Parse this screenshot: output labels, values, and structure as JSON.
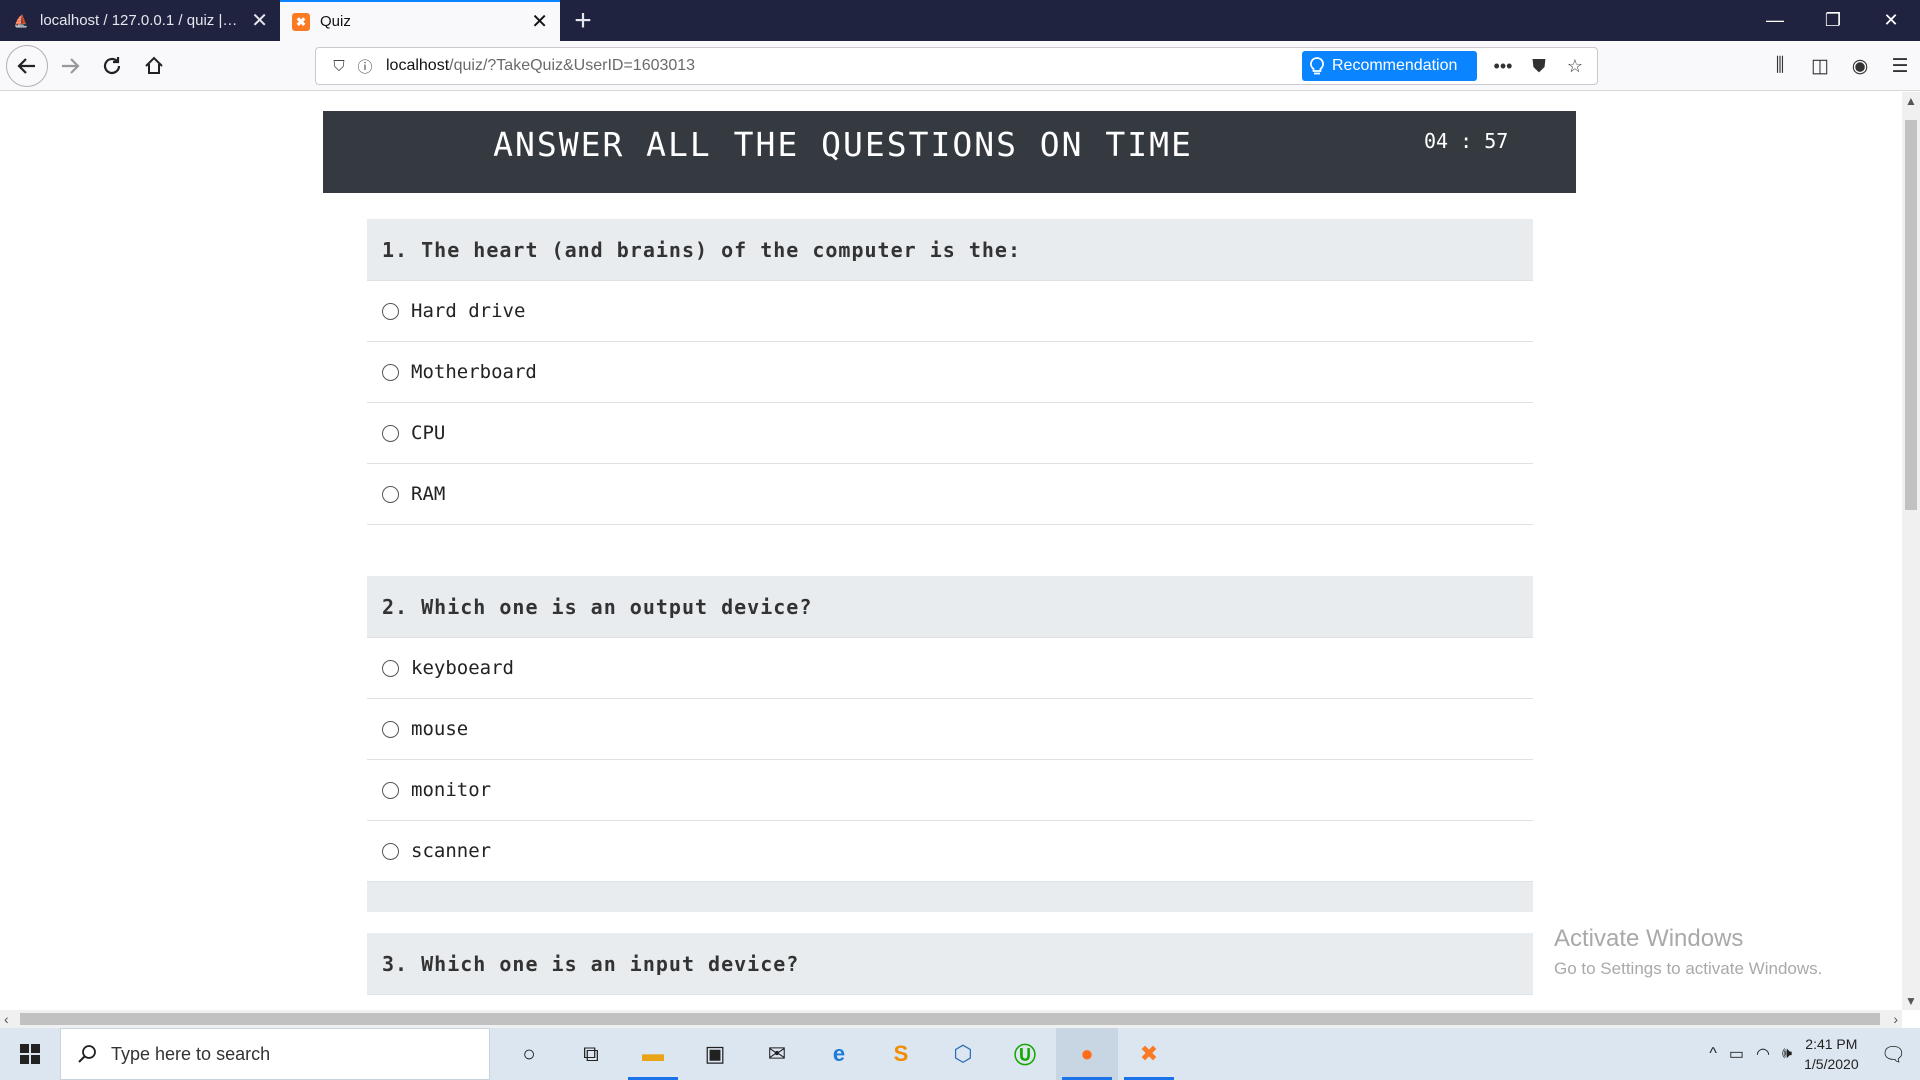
{
  "browser": {
    "tabs": [
      {
        "title": "localhost / 127.0.0.1 / quiz | php",
        "favicon": "phpmyadmin-icon",
        "active": false
      },
      {
        "title": "Quiz",
        "favicon": "xampp-icon",
        "active": true
      }
    ],
    "new_tab_label": "+",
    "url_host": "localhost",
    "url_path": "/quiz/?TakeQuiz&UserID=1603013",
    "recommendation_label": "Recommendation"
  },
  "page": {
    "banner_title": "ANSWER ALL THE QUESTIONS ON TIME",
    "timer": "04 : 57",
    "questions": [
      {
        "text": "1. The heart (and brains) of the computer is the:",
        "options": [
          "Hard drive",
          "Motherboard",
          "CPU",
          "RAM"
        ]
      },
      {
        "text": "2. Which one is an output device?",
        "options": [
          "keyboeard",
          "mouse",
          "monitor",
          "scanner"
        ]
      },
      {
        "text": "3. Which one is an input device?",
        "options": []
      }
    ]
  },
  "watermark": {
    "line1": "Activate Windows",
    "line2": "Go to Settings to activate Windows."
  },
  "taskbar": {
    "search_placeholder": "Type here to search",
    "time": "2:41 PM",
    "date": "1/5/2020"
  },
  "colors": {
    "banner_bg": "#343a40",
    "question_head_bg": "#e9ecef",
    "accent": "#0a84ff",
    "tabstrip_bg": "#202340"
  }
}
